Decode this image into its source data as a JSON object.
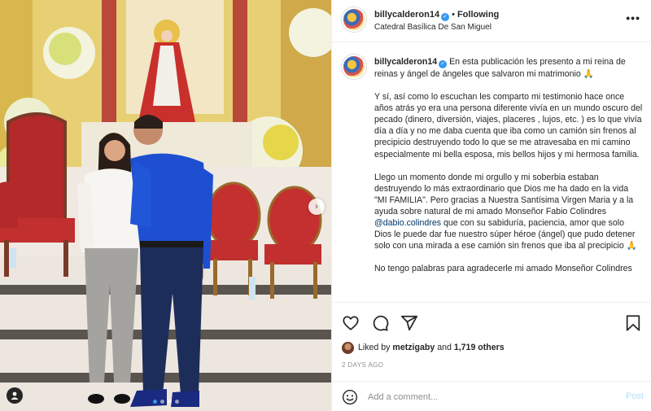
{
  "header": {
    "username": "billycalderon14",
    "separator": "•",
    "follow_status": "Following",
    "location": "Catedral Basílica De San Miguel",
    "more_icon": "more-horizontal-icon"
  },
  "caption": {
    "username": "billycalderon14",
    "lead": "En esta publicación les presento a mi reina de reinas y ángel de ángeles que salvaron mi matrimonio 🙏",
    "paragraph_1": "Y sí, así como lo escuchan les comparto mi testimonio hace once años atrás yo era una persona diferente vivía en un mundo oscuro del pecado (dinero, diversión, viajes, placeres , lujos, etc. ) es lo que vivía día a día y no me daba cuenta que iba como un camión sin frenos al precipicio destruyendo todo lo que se me atravesaba en mi camino especialmente mi bella esposa, mis bellos hijos y mi hermosa familia.",
    "paragraph_2_before": "Llego un momento donde mi orgullo y mi soberbia estaban destruyendo lo más extraordinario que Dios me ha dado en la vida \"MI FAMILIA\". Pero gracias a Nuestra Santísima Virgen Maria y a la ayuda sobre natural de mi amado Monseñor Fabio Colindres ",
    "paragraph_2_mention": "@dabio.colindres",
    "paragraph_2_after": " que con su sabiduría, paciencia, amor que solo Dios le puede dar fue nuestro súper héroe (ángel) que pudo detener solo con una mirada a ese camión sin frenos que iba al precipicio 🙏",
    "paragraph_3": "No tengo palabras para agradecerle mi amado Monseñor Colindres"
  },
  "actions": {
    "like_icon": "heart-icon",
    "comment_icon": "comment-icon",
    "share_icon": "share-icon",
    "save_icon": "bookmark-icon"
  },
  "likes": {
    "prefix": "Liked by",
    "liker": "metzigaby",
    "conjunction": "and",
    "others": "1,719 others"
  },
  "date": "2 DAYS AGO",
  "comment": {
    "placeholder": "Add a comment...",
    "post_label": "Post"
  },
  "carousel": {
    "slide_count": 4,
    "active_slide": 1
  },
  "colors": {
    "verified": "#3897f0",
    "mention": "#00376b",
    "post_disabled": "#b2dffc",
    "muted": "#8e8e8e"
  }
}
